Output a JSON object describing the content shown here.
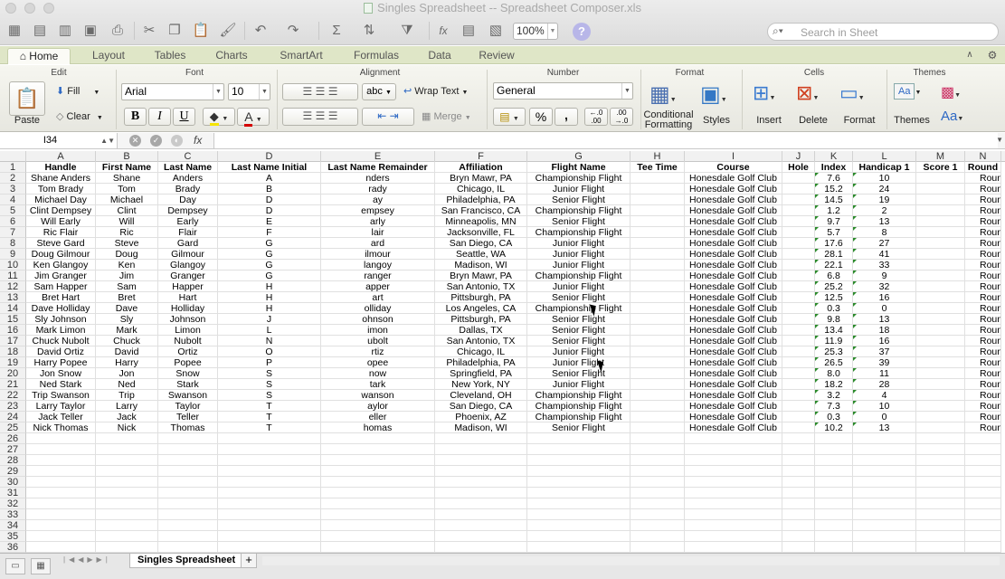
{
  "window": {
    "title": "Singles Spreadsheet -- Spreadsheet Composer.xls"
  },
  "toolbar": {
    "zoom": "100%",
    "search_placeholder": "Search in Sheet",
    "help_glyph": "?",
    "fx_glyph": "fx"
  },
  "tabs": [
    {
      "label": "Home"
    },
    {
      "label": "Layout"
    },
    {
      "label": "Tables"
    },
    {
      "label": "Charts"
    },
    {
      "label": "SmartArt"
    },
    {
      "label": "Formulas"
    },
    {
      "label": "Data"
    },
    {
      "label": "Review"
    }
  ],
  "ribbon": {
    "groups": {
      "edit": "Edit",
      "font": "Font",
      "alignment": "Alignment",
      "number": "Number",
      "format": "Format",
      "cells": "Cells",
      "themes": "Themes"
    },
    "paste": "Paste",
    "fill": "Fill",
    "clear": "Clear",
    "font_name": "Arial",
    "font_size": "10",
    "bold": "B",
    "italic": "I",
    "underline": "U",
    "wrap_text": "Wrap Text",
    "abc": "abc",
    "merge": "Merge",
    "number_format": "General",
    "percent": "%",
    "comma": ",",
    "dec_inc": "←.0\n.00",
    "dec_dec": ".00\n→.0",
    "conditional_formatting_1": "Conditional",
    "conditional_formatting_2": "Formatting",
    "styles": "Styles",
    "insert": "Insert",
    "delete": "Delete",
    "format": "Format",
    "themes": "Themes",
    "aa": "Aa"
  },
  "formula_bar": {
    "cell_ref": "I34",
    "fx": "fx",
    "value": ""
  },
  "sheet": {
    "columns": [
      "A",
      "B",
      "C",
      "D",
      "E",
      "F",
      "G",
      "H",
      "I",
      "J",
      "K",
      "L",
      "M",
      "N"
    ],
    "headers": [
      "Handle",
      "First Name",
      "Last Name",
      "Last Name Initial",
      "Last Name Remainder",
      "Affiliation",
      "Flight Name",
      "Tee Time",
      "Course",
      "Hole",
      "Index",
      "Handicap 1",
      "Score 1",
      "Round"
    ],
    "rows": [
      [
        "Shane Anders",
        "Shane",
        "Anders",
        "A",
        "nders",
        "Bryn Mawr, PA",
        "Championship Flight",
        "",
        "Honesdale Golf Club",
        "",
        "7.6",
        "10",
        "",
        "Roun"
      ],
      [
        "Tom Brady",
        "Tom",
        "Brady",
        "B",
        "rady",
        "Chicago, IL",
        "Junior Flight",
        "",
        "Honesdale Golf Club",
        "",
        "15.2",
        "24",
        "",
        "Roun"
      ],
      [
        "Michael Day",
        "Michael",
        "Day",
        "D",
        "ay",
        "Philadelphia, PA",
        "Senior Flight",
        "",
        "Honesdale Golf Club",
        "",
        "14.5",
        "19",
        "",
        "Roun"
      ],
      [
        "Clint Dempsey",
        "Clint",
        "Dempsey",
        "D",
        "empsey",
        "San Francisco, CA",
        "Championship Flight",
        "",
        "Honesdale Golf Club",
        "",
        "1.2",
        "2",
        "",
        "Roun"
      ],
      [
        "Will Early",
        "Will",
        "Early",
        "E",
        "arly",
        "Minneapolis, MN",
        "Senior Flight",
        "",
        "Honesdale Golf Club",
        "",
        "9.7",
        "13",
        "",
        "Roun"
      ],
      [
        "Ric Flair",
        "Ric",
        "Flair",
        "F",
        "lair",
        "Jacksonville, FL",
        "Championship Flight",
        "",
        "Honesdale Golf Club",
        "",
        "5.7",
        "8",
        "",
        "Roun"
      ],
      [
        "Steve Gard",
        "Steve",
        "Gard",
        "G",
        "ard",
        "San Diego, CA",
        "Junior Flight",
        "",
        "Honesdale Golf Club",
        "",
        "17.6",
        "27",
        "",
        "Roun"
      ],
      [
        "Doug Gilmour",
        "Doug",
        "Gilmour",
        "G",
        "ilmour",
        "Seattle, WA",
        "Junior Flight",
        "",
        "Honesdale Golf Club",
        "",
        "28.1",
        "41",
        "",
        "Roun"
      ],
      [
        "Ken Glangoy",
        "Ken",
        "Glangoy",
        "G",
        "langoy",
        "Madison, WI",
        "Junior Flight",
        "",
        "Honesdale Golf Club",
        "",
        "22.1",
        "33",
        "",
        "Roun"
      ],
      [
        "Jim Granger",
        "Jim",
        "Granger",
        "G",
        "ranger",
        "Bryn Mawr, PA",
        "Championship Flight",
        "",
        "Honesdale Golf Club",
        "",
        "6.8",
        "9",
        "",
        "Roun"
      ],
      [
        "Sam Happer",
        "Sam",
        "Happer",
        "H",
        "apper",
        "San Antonio, TX",
        "Junior Flight",
        "",
        "Honesdale Golf Club",
        "",
        "25.2",
        "32",
        "",
        "Roun"
      ],
      [
        "Bret Hart",
        "Bret",
        "Hart",
        "H",
        "art",
        "Pittsburgh, PA",
        "Senior Flight",
        "",
        "Honesdale Golf Club",
        "",
        "12.5",
        "16",
        "",
        "Roun"
      ],
      [
        "Dave Holliday",
        "Dave",
        "Holliday",
        "H",
        "olliday",
        "Los Angeles, CA",
        "Championship Flight",
        "",
        "Honesdale Golf Club",
        "",
        "0.3",
        "0",
        "",
        "Roun"
      ],
      [
        "Sly Johnson",
        "Sly",
        "Johnson",
        "J",
        "ohnson",
        "Pittsburgh, PA",
        "Senior Flight",
        "",
        "Honesdale Golf Club",
        "",
        "9.8",
        "13",
        "",
        "Roun"
      ],
      [
        "Mark Limon",
        "Mark",
        "Limon",
        "L",
        "imon",
        "Dallas, TX",
        "Senior Flight",
        "",
        "Honesdale Golf Club",
        "",
        "13.4",
        "18",
        "",
        "Roun"
      ],
      [
        "Chuck Nubolt",
        "Chuck",
        "Nubolt",
        "N",
        "ubolt",
        "San Antonio, TX",
        "Senior Flight",
        "",
        "Honesdale Golf Club",
        "",
        "11.9",
        "16",
        "",
        "Roun"
      ],
      [
        "David Ortiz",
        "David",
        "Ortiz",
        "O",
        "rtiz",
        "Chicago, IL",
        "Junior Flight",
        "",
        "Honesdale Golf Club",
        "",
        "25.3",
        "37",
        "",
        "Roun"
      ],
      [
        "Harry Popee",
        "Harry",
        "Popee",
        "P",
        "opee",
        "Philadelphia, PA",
        "Junior Flight",
        "",
        "Honesdale Golf Club",
        "",
        "26.5",
        "39",
        "",
        "Roun"
      ],
      [
        "Jon Snow",
        "Jon",
        "Snow",
        "S",
        "now",
        "Springfield, PA",
        "Senior Flight",
        "",
        "Honesdale Golf Club",
        "",
        "8.0",
        "11",
        "",
        "Roun"
      ],
      [
        "Ned Stark",
        "Ned",
        "Stark",
        "S",
        "tark",
        "New York, NY",
        "Junior Flight",
        "",
        "Honesdale Golf Club",
        "",
        "18.2",
        "28",
        "",
        "Roun"
      ],
      [
        "Trip Swanson",
        "Trip",
        "Swanson",
        "S",
        "wanson",
        "Cleveland, OH",
        "Championship Flight",
        "",
        "Honesdale Golf Club",
        "",
        "3.2",
        "4",
        "",
        "Roun"
      ],
      [
        "Larry Taylor",
        "Larry",
        "Taylor",
        "T",
        "aylor",
        "San Diego, CA",
        "Championship Flight",
        "",
        "Honesdale Golf Club",
        "",
        "7.3",
        "10",
        "",
        "Roun"
      ],
      [
        "Jack Teller",
        "Jack",
        "Teller",
        "T",
        "eller",
        "Phoenix, AZ",
        "Championship Flight",
        "",
        "Honesdale Golf Club",
        "",
        "0.3",
        "0",
        "",
        "Roun"
      ],
      [
        "Nick Thomas",
        "Nick",
        "Thomas",
        "T",
        "homas",
        "Madison, WI",
        "Senior Flight",
        "",
        "Honesdale Golf Club",
        "",
        "10.2",
        "13",
        "",
        "Roun"
      ]
    ],
    "row_count": 36
  },
  "sheet_tabs": [
    {
      "label": "Singles Spreadsheet"
    }
  ],
  "add_sheet": "+",
  "colors": {
    "tab_bar": "#dfe6c7",
    "ribbon": "#f2f2ec",
    "flag_green": "#2a8a2a"
  }
}
